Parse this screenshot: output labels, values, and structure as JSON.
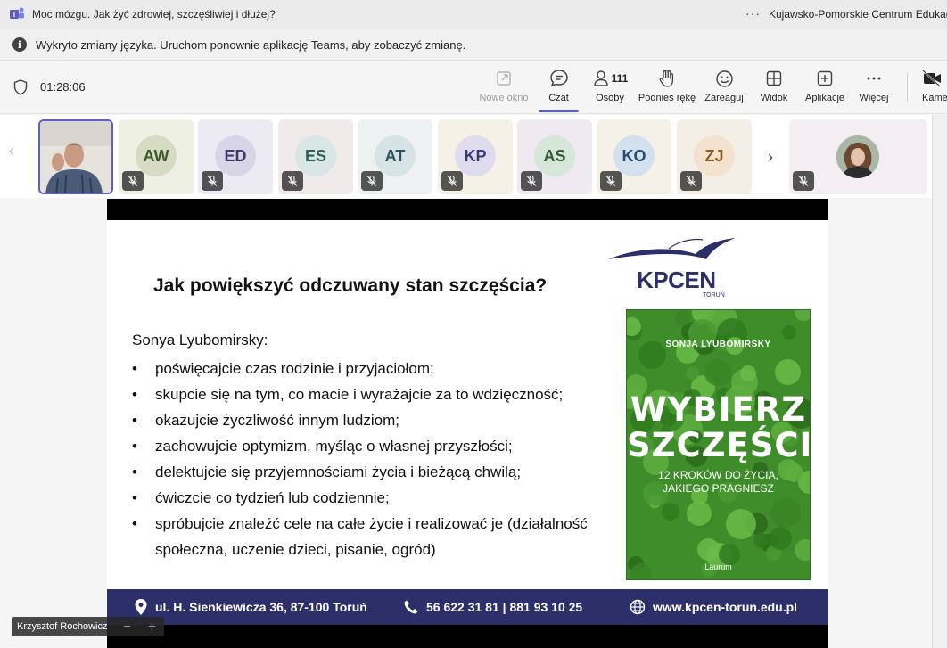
{
  "window": {
    "title": "Moc mózgu. Jak żyć zdrowiej, szczęśliwiej i dłużej?",
    "more_label": "···",
    "organization": "Kujawsko-Pomorskie Centrum Edukac"
  },
  "notice": {
    "text": "Wykryto zmiany języka. Uruchom ponownie aplikację Teams, aby zobaczyć zmianę."
  },
  "meeting": {
    "timer": "01:28:06"
  },
  "toolbar": {
    "new_window": "Nowe okno",
    "chat": "Czat",
    "people": "Osoby",
    "people_count": "111",
    "raise_hand": "Podnieś rękę",
    "react": "Zareaguj",
    "view": "Widok",
    "apps": "Aplikacje",
    "more": "Więcej",
    "camera": "Kamera"
  },
  "participants": [
    {
      "initials": "AW",
      "bg": "#eef0e4",
      "circle": "#d5dcc3",
      "fg": "#3d5a2a"
    },
    {
      "initials": "ED",
      "bg": "#ecebf3",
      "circle": "#d7d5e6",
      "fg": "#3f3a6b"
    },
    {
      "initials": "ES",
      "bg": "#f1eaea",
      "circle": "#d8e7e3",
      "fg": "#2f5f55"
    },
    {
      "initials": "AT",
      "bg": "#eef1f1",
      "circle": "#d6e4e6",
      "fg": "#2c5560"
    },
    {
      "initials": "KP",
      "bg": "#f4f1e6",
      "circle": "#dfdcf0",
      "fg": "#3c3873"
    },
    {
      "initials": "AS",
      "bg": "#efeaf2",
      "circle": "#d6e6d8",
      "fg": "#2e5a36"
    },
    {
      "initials": "KO",
      "bg": "#f4f1e8",
      "circle": "#d3e1ee",
      "fg": "#274c70"
    },
    {
      "initials": "ZJ",
      "bg": "#f4efe6",
      "circle": "#f2e2cf",
      "fg": "#8a5d22"
    }
  ],
  "slide": {
    "title": "Jak powiększyć odczuwany stan szczęścia?",
    "author_line": "Sonya Lyubomirsky:",
    "bullets": [
      "poświęcajcie czas rodzinie i przyjaciołom;",
      "skupcie się na tym, co macie i wyrażajcie za to wdzięczność;",
      "okazujcie życzliwość innym ludziom;",
      "zachowujcie optymizm, myśląc o własnej przyszłości;",
      "delektujcie się przyjemnościami życia i bieżącą chwilą;",
      "ćwiczcie co tydzień lub codziennie;",
      "spróbujcie znaleźć cele na całe życie i realizować je (działalność społeczna, uczenie dzieci, pisanie, ogród)"
    ],
    "logo_name": "KPCEN",
    "logo_city": "TORUŃ",
    "book": {
      "author": "SONJA LYUBOMIRSKY",
      "title_line1": "WYBIERZ",
      "title_line2": "SZCZĘŚCIE",
      "subtitle_line1": "12 KROKÓW DO ŻYCIA,",
      "subtitle_line2": "JAKIEGO PRAGNIESZ",
      "publisher": "Laurum"
    },
    "footer": {
      "address": "ul. H. Sienkiewicza 36, 87-100 Toruń",
      "phones": "56 622 31 81 | 881 93 10 25",
      "website": "www.kpcen-torun.edu.pl"
    }
  },
  "presenter": {
    "name": "Krzysztof Rochowicz",
    "zoom_out": "−",
    "zoom_in": "+"
  },
  "colors": {
    "accent": "#5b5fc7",
    "footer": "#2d2f6b",
    "book_green": "#3f8d2a"
  }
}
